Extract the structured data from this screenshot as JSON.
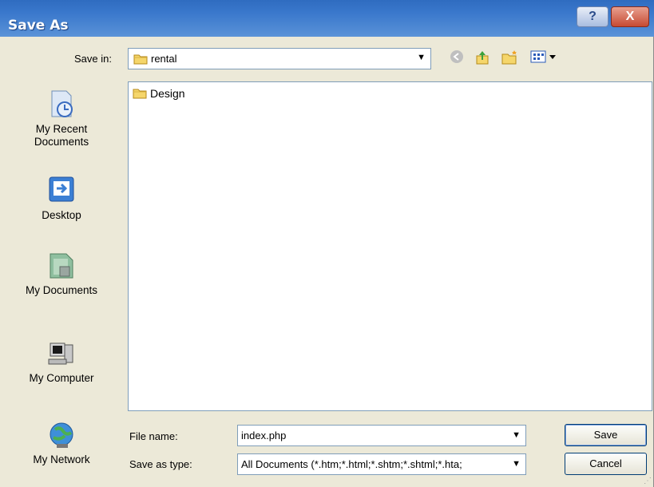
{
  "window": {
    "title": "Save As",
    "help_label": "?",
    "close_label": "X"
  },
  "toolbar": {
    "save_in_label": "Save in:",
    "save_in_value": "rental",
    "dropdown_arrow": "▼",
    "back_icon": "back-icon",
    "up_icon": "up-folder-icon",
    "newfolder_icon": "new-folder-icon",
    "views_icon": "views-menu-icon"
  },
  "places": [
    {
      "label": "My Recent\nDocuments",
      "icon": "recent-documents-icon"
    },
    {
      "label": "Desktop",
      "icon": "desktop-icon"
    },
    {
      "label": "My Documents",
      "icon": "my-documents-icon"
    },
    {
      "label": "My Computer",
      "icon": "my-computer-icon"
    },
    {
      "label": "My Network",
      "icon": "my-network-icon"
    }
  ],
  "files": [
    {
      "name": "Design",
      "icon": "folder-icon"
    }
  ],
  "form": {
    "filename_label": "File name:",
    "filename_value": "index.php",
    "type_label": "Save as type:",
    "type_value": "All Documents (*.htm;*.html;*.shtm;*.shtml;*.hta;",
    "save_label": "Save",
    "cancel_label": "Cancel"
  },
  "colors": {
    "titlebar": "#3a78cc",
    "dialog_bg": "#ece9d8",
    "border": "#7f9db9"
  }
}
